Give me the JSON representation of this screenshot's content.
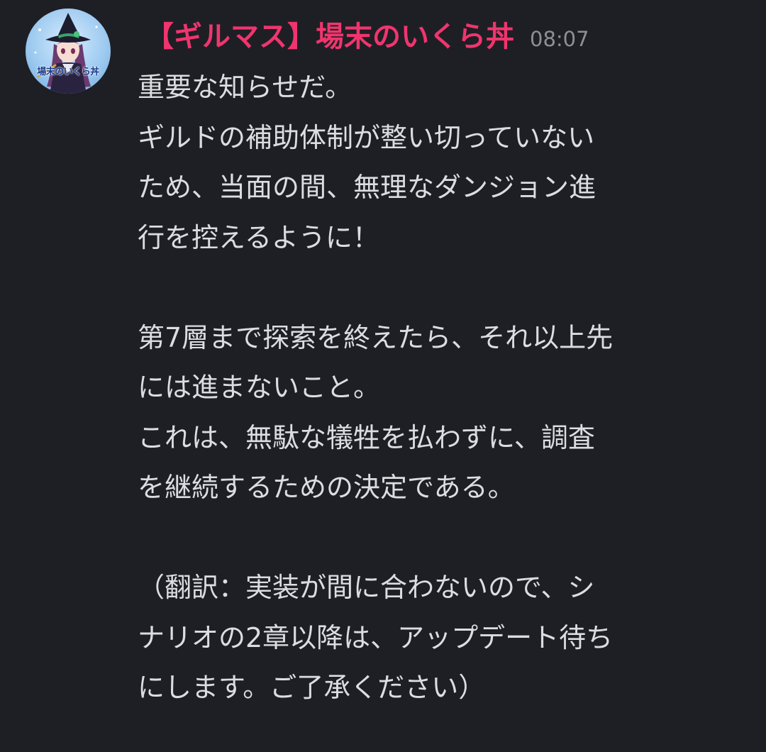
{
  "message": {
    "author": "【ギルマス】場末のいくら丼",
    "author_color": "#f0356e",
    "timestamp": "08:07",
    "avatar_caption": "場末のいくら丼",
    "paragraphs": [
      [
        "重要な知らせだ。",
        "ギルドの補助体制が整い切っていない",
        "ため、当面の間、無理なダンジョン進",
        "行を控えるように！"
      ],
      [
        "第7層まで探索を終えたら、それ以上先",
        "には進まないこと。",
        "これは、無駄な犠牲を払わずに、調査",
        "を継続するための決定である。"
      ],
      [
        "（翻訳：実装が間に合わないので、シ",
        "ナリオの2章以降は、アップデート待ち",
        "にします。ご了承ください）"
      ]
    ]
  }
}
